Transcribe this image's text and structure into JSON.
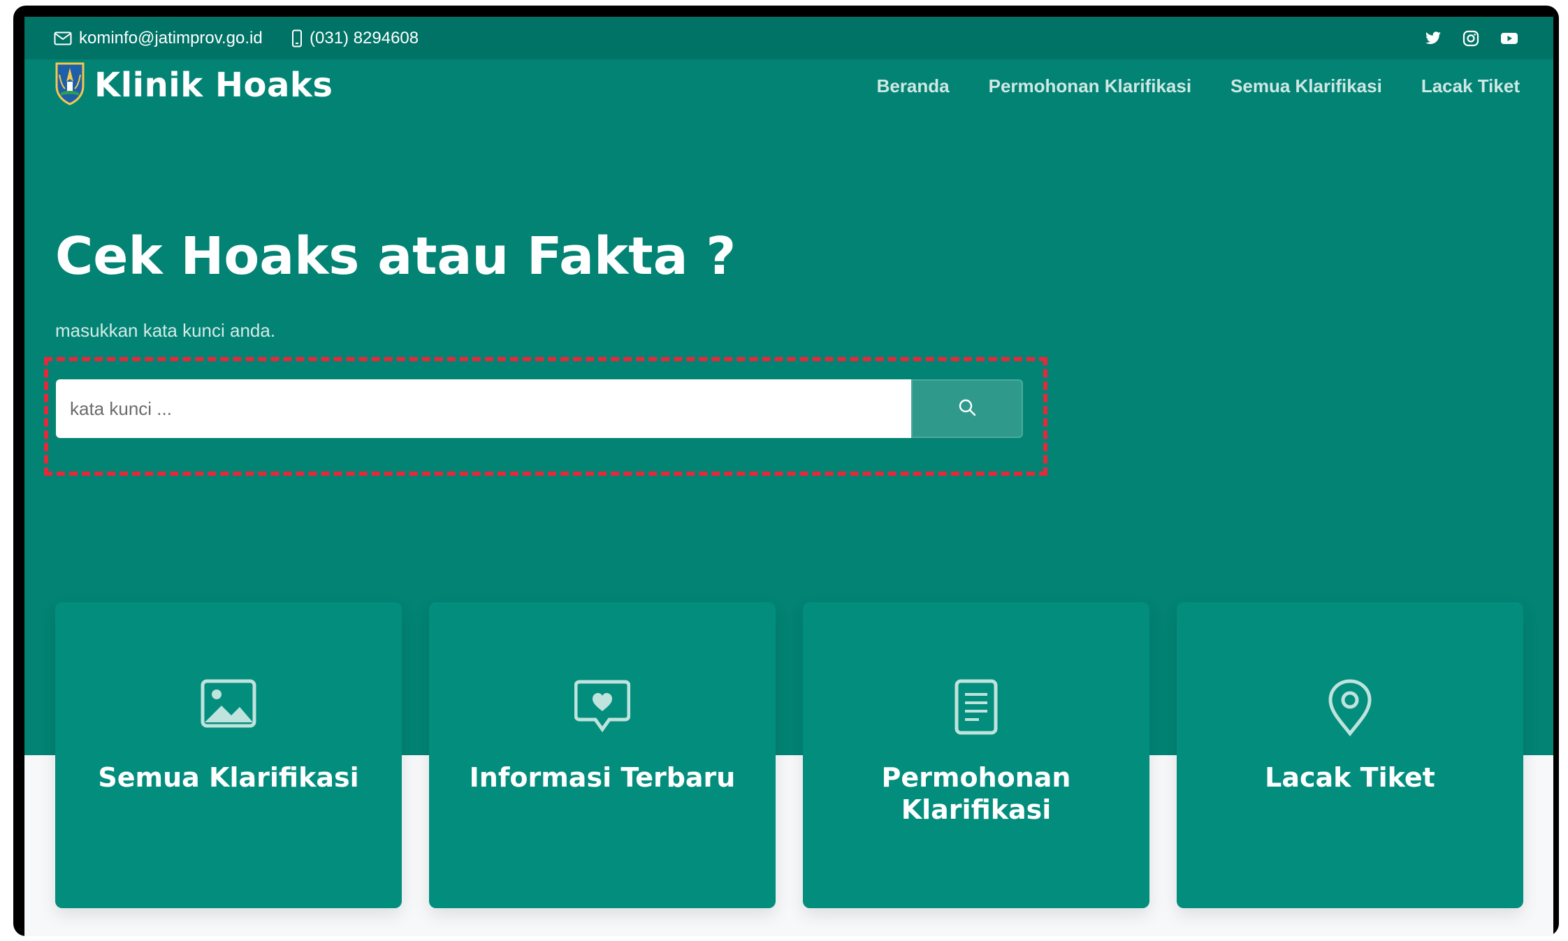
{
  "topbar": {
    "email": "kominfo@jatimprov.go.id",
    "phone": "(031) 8294608",
    "social": [
      "twitter-icon",
      "instagram-icon",
      "youtube-icon"
    ]
  },
  "brand": {
    "title": "Klinik Hoaks"
  },
  "nav": {
    "items": [
      {
        "label": "Beranda"
      },
      {
        "label": "Permohonan Klarifikasi"
      },
      {
        "label": "Semua Klarifikasi"
      },
      {
        "label": "Lacak Tiket"
      }
    ]
  },
  "hero": {
    "title": "Cek Hoaks atau Fakta ?",
    "subtitle": "masukkan kata kunci anda.",
    "search_placeholder": "kata kunci ..."
  },
  "cards": [
    {
      "label": "Semua Klarifikasi",
      "icon": "image-icon"
    },
    {
      "label": "Informasi Terbaru",
      "icon": "chat-heart-icon"
    },
    {
      "label": "Permohonan Klarifikasi",
      "icon": "document-icon"
    },
    {
      "label": "Lacak Tiket",
      "icon": "location-pin-icon"
    }
  ],
  "colors": {
    "primary": "#028374",
    "topbar": "#007366",
    "card": "#028d7d",
    "highlight": "#e5283a"
  }
}
